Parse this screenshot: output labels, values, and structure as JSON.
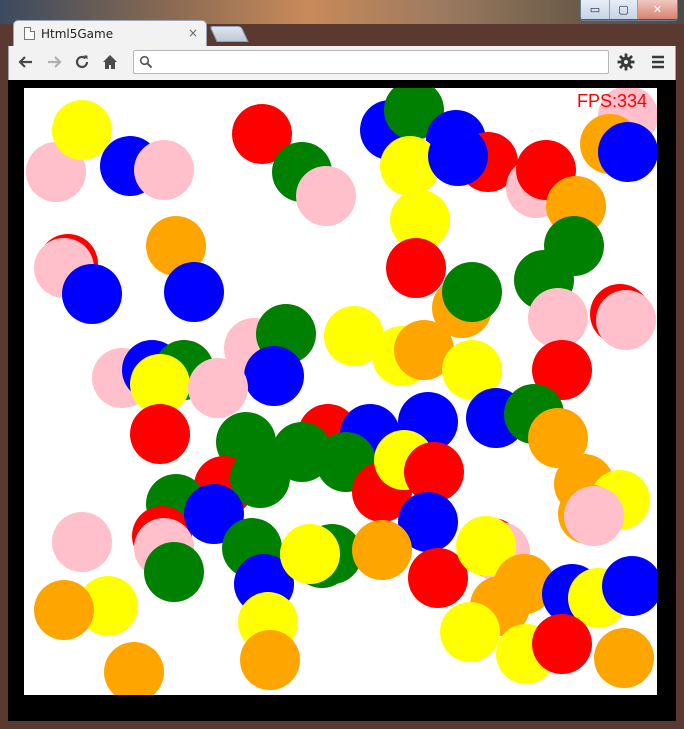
{
  "browser": {
    "tab_title": "Html5Game",
    "tab_close": "×",
    "omnibox_value": "",
    "omnibox_placeholder": "",
    "window_controls": {
      "minimize": "▭",
      "maximize": "▢",
      "close": "✕"
    }
  },
  "game": {
    "fps_text": "FPS:334",
    "fps_color": "#ff0000",
    "background": "#ffffff",
    "colors": {
      "red": "#ff0000",
      "blue": "#0000ff",
      "green": "#008000",
      "yellow": "#ffff00",
      "orange": "#ffa500",
      "pink": "#ffc0cb"
    }
  }
}
